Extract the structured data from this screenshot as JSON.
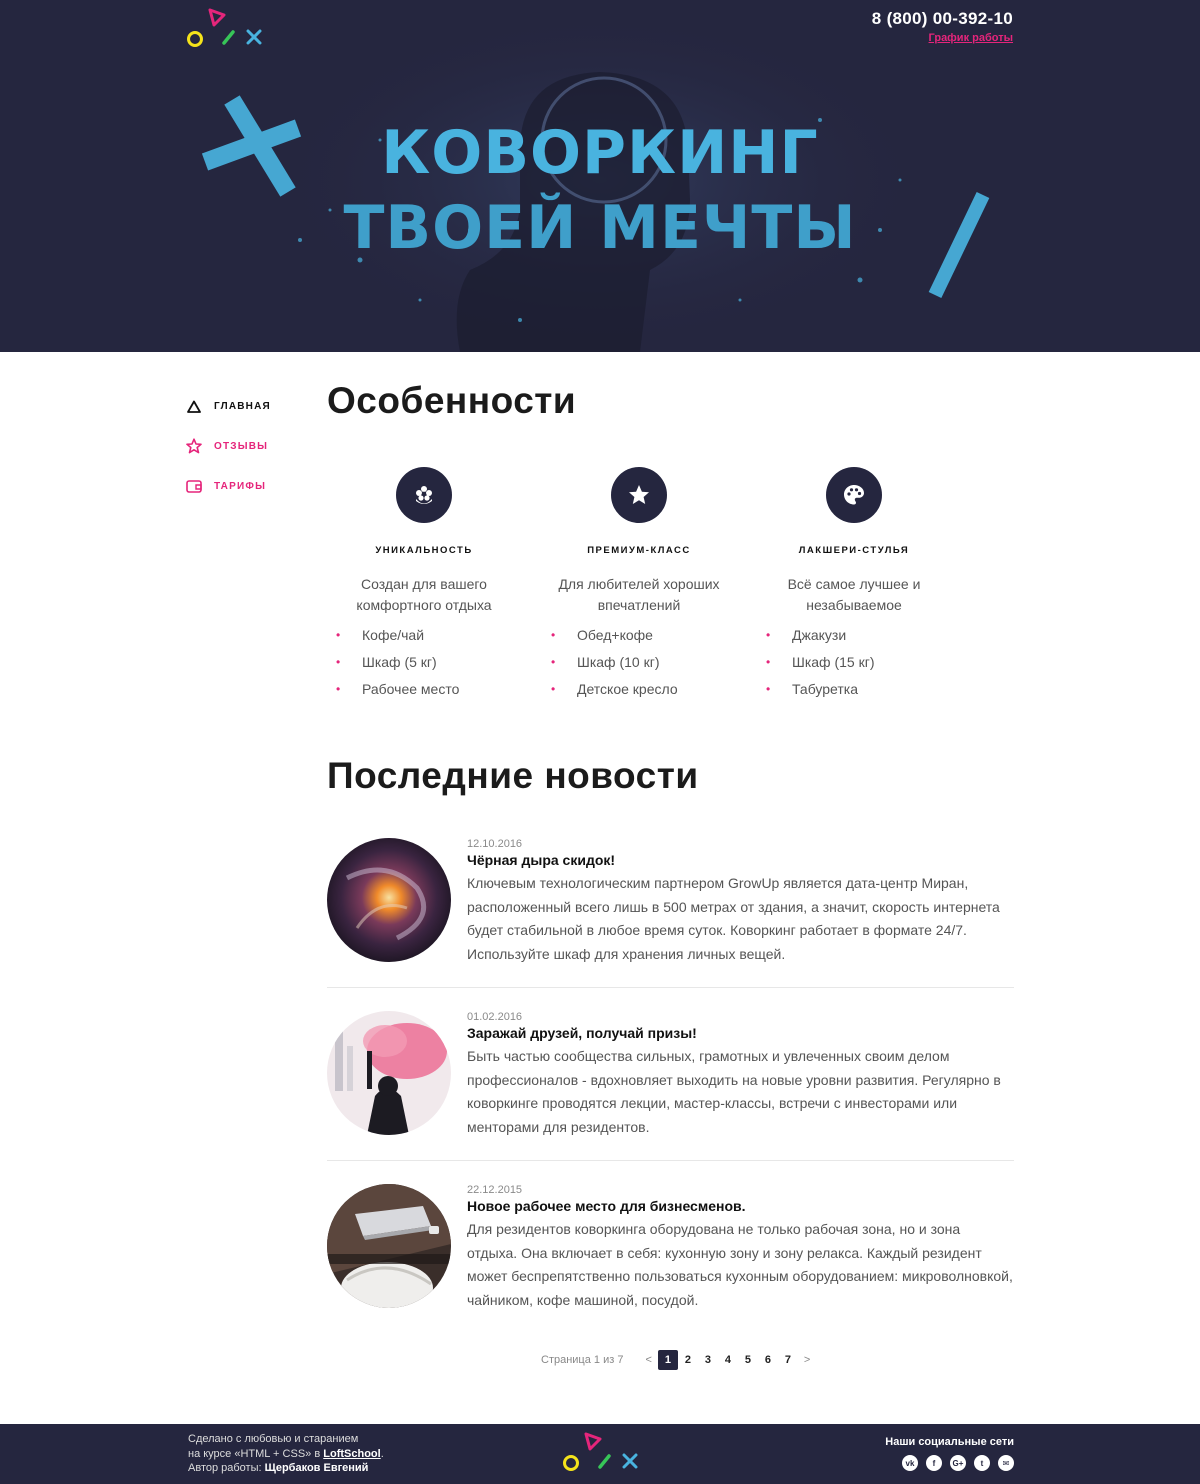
{
  "header": {
    "phone": "8 (800) 00-392-10",
    "schedule_link": "График работы",
    "hero_line1": "Коворкинг",
    "hero_line2": "твоей мечты"
  },
  "colors": {
    "dark": "#25263f",
    "accent_pink": "#e5257b",
    "hero_blue": "#49b3df"
  },
  "sidebar": {
    "items": [
      {
        "label": "Главная",
        "icon": "triangle-icon",
        "active": true
      },
      {
        "label": "Отзывы",
        "icon": "star-icon",
        "active": false
      },
      {
        "label": "Тарифы",
        "icon": "wallet-icon",
        "active": false
      }
    ]
  },
  "features": {
    "title": "Особенности",
    "items": [
      {
        "icon": "flower-icon",
        "name": "Уникальность",
        "desc": "Создан для вашего комфортного отдыха",
        "list": [
          "Кофе/чай",
          "Шкаф (5 кг)",
          "Рабочее место"
        ]
      },
      {
        "icon": "star-icon",
        "name": "Премиум-класс",
        "desc": "Для любителей хороших впечатлений",
        "list": [
          "Обед+кофе",
          "Шкаф (10 кг)",
          "Детское кресло"
        ]
      },
      {
        "icon": "palette-icon",
        "name": "Лакшери-стулья",
        "desc": "Всё самое лучшее и незабываемое",
        "list": [
          "Джакузи",
          "Шкаф (15 кг)",
          "Табуретка"
        ]
      }
    ]
  },
  "news": {
    "title": "Последние новости",
    "items": [
      {
        "date": "12.10.2016",
        "title": "Чёрная дыра скидок!",
        "text": "Ключевым технологическим партнером GrowUp является дата-центр Миран, расположенный всего лишь в 500 метрах от здания, а значит, скорость интернета будет стабильной в любое время суток. Коворкинг работает в формате 24/7. Используйте шкаф для хранения личных вещей."
      },
      {
        "date": "01.02.2016",
        "title": "Заражай друзей, получай призы!",
        "text": "Быть частью сообщества сильных, грамотных и увлеченных своим делом профессионалов - вдохновляет выходить на новые уровни развития. Регулярно в коворкинге проводятся лекции, мастер-классы, встречи с инвесторами или менторами для резидентов."
      },
      {
        "date": "22.12.2015",
        "title": "Новое рабочее место для бизнесменов.",
        "text": "Для резидентов коворкинга оборудована не только рабочая зона, но и зона отдыха. Она включает в себя: кухонную зону и зону релакса. Каждый резидент может беспрепятственно пользоваться кухонным оборудованием: микроволновкой, чайником, кофе машиной, посудой."
      }
    ]
  },
  "pagination": {
    "info": "Страница 1 из 7",
    "prev": "<",
    "next": ">",
    "pages": [
      "1",
      "2",
      "3",
      "4",
      "5",
      "6",
      "7"
    ],
    "current": "1"
  },
  "footer": {
    "line1": "Сделано с любовью и старанием",
    "line2_prefix": "на курсе «HTML + CSS» в",
    "line2_link": "LoftSchool",
    "line2_suffix": ".",
    "line3_prefix": "Автор работы:",
    "line3_author": "Щербаков Евгений",
    "social_title": "Наши социальные сети",
    "socials": [
      {
        "icon": "vk-icon",
        "glyph": "vk"
      },
      {
        "icon": "facebook-icon",
        "glyph": "f"
      },
      {
        "icon": "google-plus-icon",
        "glyph": "G+"
      },
      {
        "icon": "twitter-icon",
        "glyph": "t"
      },
      {
        "icon": "mail-icon",
        "glyph": "✉"
      }
    ]
  }
}
